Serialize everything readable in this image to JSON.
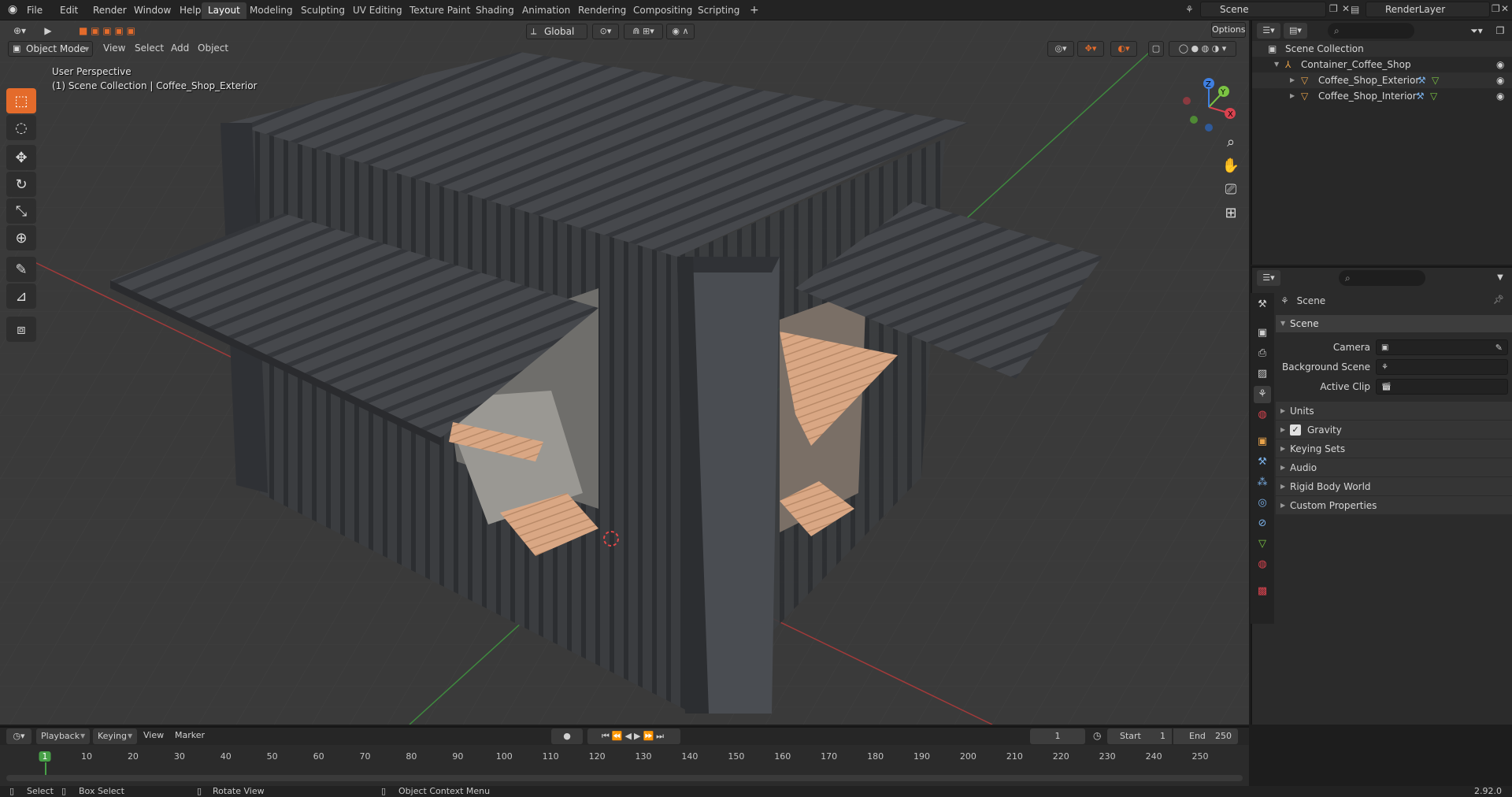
{
  "menu": [
    "File",
    "Edit",
    "Render",
    "Window",
    "Help"
  ],
  "workspaces": [
    "Layout",
    "Modeling",
    "Sculpting",
    "UV Editing",
    "Texture Paint",
    "Shading",
    "Animation",
    "Rendering",
    "Compositing",
    "Scripting"
  ],
  "active_workspace": "Layout",
  "add_workspace": "+",
  "scene_name": "Scene",
  "render_layer": "RenderLayer",
  "header": {
    "mode": "Object Mode",
    "menus": [
      "View",
      "Select",
      "Add",
      "Object"
    ],
    "orientation": "Global",
    "options": "Options"
  },
  "viewport": {
    "perspective": "User Perspective",
    "collection_info": "(1) Scene Collection | Coffee_Shop_Exterior",
    "gizmo": {
      "x": "X",
      "y": "Y",
      "z": "Z"
    }
  },
  "outliner": {
    "root": "Scene Collection",
    "collection": "Container_Coffee_Shop",
    "objects": [
      "Coffee_Shop_Exterior",
      "Coffee_Shop_Interior"
    ]
  },
  "properties": {
    "context": "Scene",
    "panel": "Scene",
    "rows": [
      {
        "label": "Camera"
      },
      {
        "label": "Background Scene"
      },
      {
        "label": "Active Clip"
      }
    ],
    "subpanels": [
      "Units",
      "Gravity",
      "Keying Sets",
      "Audio",
      "Rigid Body World",
      "Custom Properties"
    ],
    "gravity_enabled": true
  },
  "timeline": {
    "menus": [
      "Playback",
      "Keying",
      "View",
      "Marker"
    ],
    "current_frame": "1",
    "start_label": "Start",
    "start": "1",
    "end_label": "End",
    "end": "250",
    "ticks": [
      "1",
      "10",
      "20",
      "30",
      "40",
      "50",
      "60",
      "70",
      "80",
      "90",
      "100",
      "110",
      "120",
      "130",
      "140",
      "150",
      "160",
      "170",
      "180",
      "190",
      "200",
      "210",
      "220",
      "230",
      "240",
      "250"
    ]
  },
  "status": {
    "select": "Select",
    "box_select": "Box Select",
    "rotate_view": "Rotate View",
    "context_menu": "Object Context Menu",
    "version": "2.92.0"
  },
  "colors": {
    "accent": "#e46b2b",
    "axis_x": "#d9434f",
    "axis_y": "#7bc443",
    "axis_z": "#3f7fe0",
    "frame_marker": "#47a047"
  }
}
